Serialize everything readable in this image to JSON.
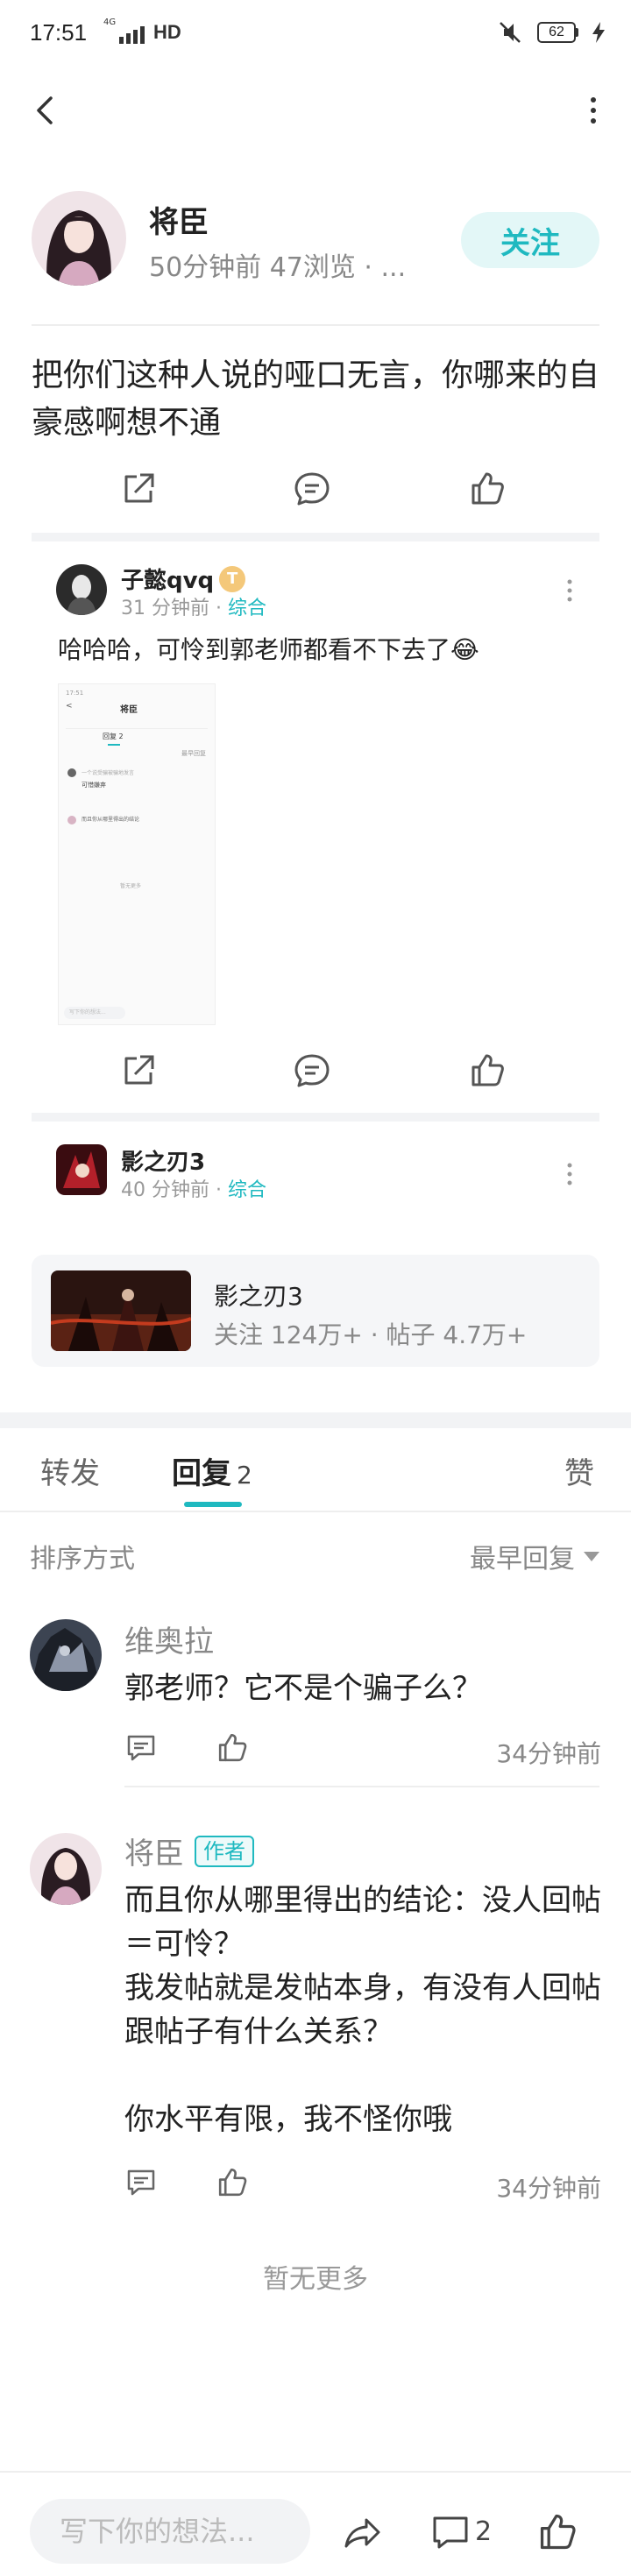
{
  "status_bar": {
    "time": "17:51",
    "network_tiny": "4G",
    "network": "HD",
    "battery": "62"
  },
  "author": {
    "name": "将臣",
    "meta": "50分钟前  47浏览 · ...",
    "follow_label": "关注"
  },
  "post": {
    "text": "把你们这种人说的哑口无言，你哪来的自豪感啊想不通"
  },
  "repost": {
    "user": "子懿qvq",
    "level_badge": "T",
    "time": "31 分钟前",
    "separator": " · ",
    "tag": "综合",
    "text": "哈哈哈，可怜到郭老师都看不下去了😂",
    "thumbnail": {
      "title": "将臣",
      "tab": "回复 2",
      "sort": "最早回复",
      "comment1": "一个说受骗被骗地发言",
      "comment2": "可惜嫌弃",
      "comment3": "而且你从哪里得出的结论",
      "footer": "暂无更多",
      "input": "写下你的想法..."
    }
  },
  "game_post": {
    "user": "影之刃3",
    "time": "40 分钟前",
    "separator": " · ",
    "tag": "综合"
  },
  "game_card": {
    "title": "影之刃3",
    "stats": "关注 124万+ · 帖子 4.7万+"
  },
  "tabs": {
    "repost": "转发",
    "reply": "回复",
    "reply_count": "2",
    "like": "赞"
  },
  "sort": {
    "label": "排序方式",
    "value": "最早回复"
  },
  "comments": [
    {
      "name": "维奥拉",
      "badge": "",
      "text": "郭老师？它不是个骗子么？",
      "time": "34分钟前"
    },
    {
      "name": "将臣",
      "badge": "作者",
      "text": "而且你从哪里得出的结论：没人回帖＝可怜？\n我发帖就是发帖本身，有没有人回帖跟帖子有什么关系？\n\n你水平有限，我不怪你哦",
      "time": "34分钟前"
    }
  ],
  "footer": {
    "no_more": "暂无更多"
  },
  "bottom_bar": {
    "placeholder": "写下你的想法...",
    "comment_count": "2"
  },
  "colors": {
    "accent": "#1fb9c0",
    "follow_bg": "#e3f7f7",
    "secondary_text": "#888888"
  }
}
